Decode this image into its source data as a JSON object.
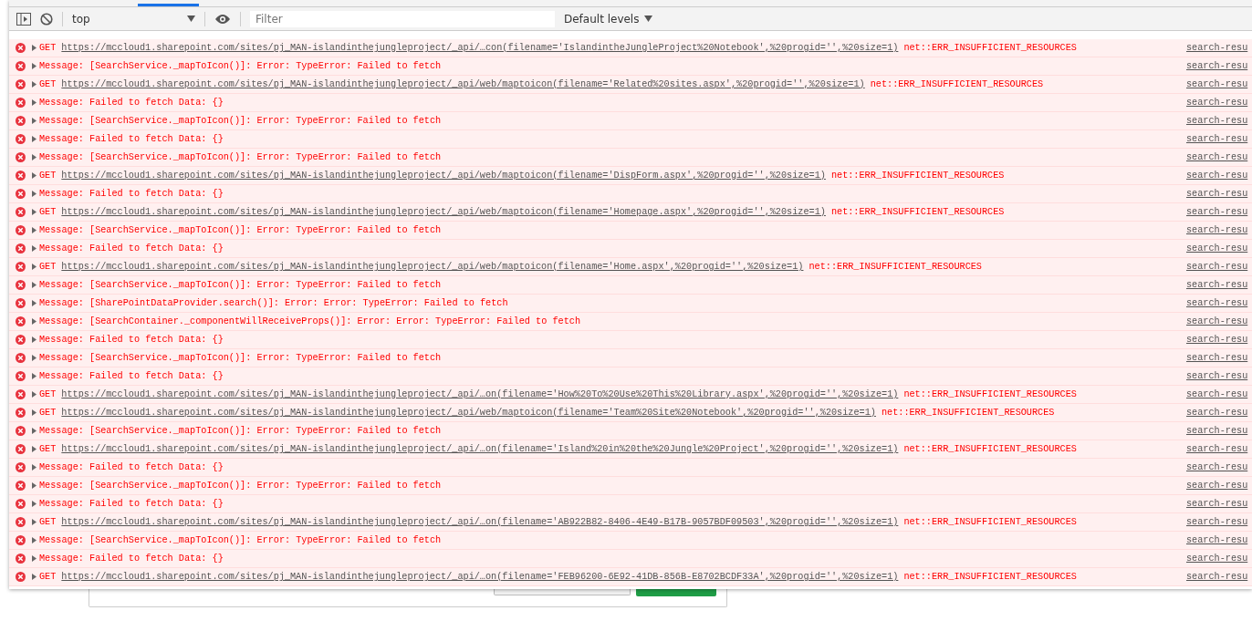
{
  "toolbar": {
    "context": "top",
    "filter": {
      "placeholder": "Filter"
    },
    "levels": "Default levels"
  },
  "console": [
    {
      "kind": "request",
      "method": "GET",
      "url": "https://mccloud1.sharepoint.com/sites/pj_MAN-islandinthejungleproject/_api/…con(filename='IslandintheJungleProject%20Notebook',%20progid='',%20size=1)",
      "error": "net::ERR_INSUFFICIENT_RESOURCES",
      "source": "search-resu"
    },
    {
      "kind": "message",
      "text": "Message: [SearchService._mapToIcon()]: Error: TypeError: Failed to fetch",
      "source": "search-resu"
    },
    {
      "kind": "request",
      "method": "GET",
      "url": "https://mccloud1.sharepoint.com/sites/pj_MAN-islandinthejungleproject/_api/web/maptoicon(filename='Related%20sites.aspx',%20progid='',%20size=1)",
      "error": "net::ERR_INSUFFICIENT_RESOURCES",
      "source": "search-resu"
    },
    {
      "kind": "message",
      "text": "Message: Failed to fetch Data: {}",
      "source": "search-resu"
    },
    {
      "kind": "message",
      "text": "Message: [SearchService._mapToIcon()]: Error: TypeError: Failed to fetch",
      "source": "search-resu"
    },
    {
      "kind": "message",
      "text": "Message: Failed to fetch Data: {}",
      "source": "search-resu"
    },
    {
      "kind": "message",
      "text": "Message: [SearchService._mapToIcon()]: Error: TypeError: Failed to fetch",
      "source": "search-resu"
    },
    {
      "kind": "request",
      "method": "GET",
      "url": "https://mccloud1.sharepoint.com/sites/pj_MAN-islandinthejungleproject/_api/web/maptoicon(filename='DispForm.aspx',%20progid='',%20size=1)",
      "error": "net::ERR_INSUFFICIENT_RESOURCES",
      "source": "search-resu"
    },
    {
      "kind": "message",
      "text": "Message: Failed to fetch Data: {}",
      "source": "search-resu"
    },
    {
      "kind": "request",
      "method": "GET",
      "url": "https://mccloud1.sharepoint.com/sites/pj_MAN-islandinthejungleproject/_api/web/maptoicon(filename='Homepage.aspx',%20progid='',%20size=1)",
      "error": "net::ERR_INSUFFICIENT_RESOURCES",
      "source": "search-resu"
    },
    {
      "kind": "message",
      "text": "Message: [SearchService._mapToIcon()]: Error: TypeError: Failed to fetch",
      "source": "search-resu"
    },
    {
      "kind": "message",
      "text": "Message: Failed to fetch Data: {}",
      "source": "search-resu"
    },
    {
      "kind": "request",
      "method": "GET",
      "url": "https://mccloud1.sharepoint.com/sites/pj_MAN-islandinthejungleproject/_api/web/maptoicon(filename='Home.aspx',%20progid='',%20size=1)",
      "error": "net::ERR_INSUFFICIENT_RESOURCES",
      "source": "search-resu"
    },
    {
      "kind": "message",
      "text": "Message: [SearchService._mapToIcon()]: Error: TypeError: Failed to fetch",
      "source": "search-resu"
    },
    {
      "kind": "message",
      "text": "Message: [SharePointDataProvider.search()]: Error: Error: TypeError: Failed to fetch",
      "source": "search-resu"
    },
    {
      "kind": "message",
      "text": "Message: [SearchContainer._componentWillReceiveProps()]: Error: Error: TypeError: Failed to fetch",
      "source": "search-resu"
    },
    {
      "kind": "message",
      "text": "Message: Failed to fetch Data: {}",
      "source": "search-resu"
    },
    {
      "kind": "message",
      "text": "Message: [SearchService._mapToIcon()]: Error: TypeError: Failed to fetch",
      "source": "search-resu"
    },
    {
      "kind": "message",
      "text": "Message: Failed to fetch Data: {}",
      "source": "search-resu"
    },
    {
      "kind": "request",
      "method": "GET",
      "url": "https://mccloud1.sharepoint.com/sites/pj_MAN-islandinthejungleproject/_api/…on(filename='How%20To%20Use%20This%20Library.aspx',%20progid='',%20size=1)",
      "error": "net::ERR_INSUFFICIENT_RESOURCES",
      "source": "search-resu"
    },
    {
      "kind": "request",
      "method": "GET",
      "url": "https://mccloud1.sharepoint.com/sites/pj_MAN-islandinthejungleproject/_api/web/maptoicon(filename='Team%20Site%20Notebook',%20progid='',%20size=1)",
      "error": "net::ERR_INSUFFICIENT_RESOURCES",
      "source": "search-resu"
    },
    {
      "kind": "message",
      "text": "Message: [SearchService._mapToIcon()]: Error: TypeError: Failed to fetch",
      "source": "search-resu"
    },
    {
      "kind": "request",
      "method": "GET",
      "url": "https://mccloud1.sharepoint.com/sites/pj_MAN-islandinthejungleproject/_api/…on(filename='Island%20in%20the%20Jungle%20Project',%20progid='',%20size=1)",
      "error": "net::ERR_INSUFFICIENT_RESOURCES",
      "source": "search-resu"
    },
    {
      "kind": "message",
      "text": "Message: Failed to fetch Data: {}",
      "source": "search-resu"
    },
    {
      "kind": "message",
      "text": "Message: [SearchService._mapToIcon()]: Error: TypeError: Failed to fetch",
      "source": "search-resu"
    },
    {
      "kind": "message",
      "text": "Message: Failed to fetch Data: {}",
      "source": "search-resu"
    },
    {
      "kind": "request",
      "method": "GET",
      "url": "https://mccloud1.sharepoint.com/sites/pj_MAN-islandinthejungleproject/_api/…on(filename='AB922B82-8406-4E49-B17B-9057BDF09503',%20progid='',%20size=1)",
      "error": "net::ERR_INSUFFICIENT_RESOURCES",
      "source": "search-resu"
    },
    {
      "kind": "message",
      "text": "Message: [SearchService._mapToIcon()]: Error: TypeError: Failed to fetch",
      "source": "search-resu"
    },
    {
      "kind": "message",
      "text": "Message: Failed to fetch Data: {}",
      "source": "search-resu"
    },
    {
      "kind": "request",
      "method": "GET",
      "url": "https://mccloud1.sharepoint.com/sites/pj_MAN-islandinthejungleproject/_api/…on(filename='FEB96200-6E92-41DB-856B-E8702BCDF33A',%20progid='',%20size=1)",
      "error": "net::ERR_INSUFFICIENT_RESOURCES",
      "source": "search-resu"
    }
  ]
}
